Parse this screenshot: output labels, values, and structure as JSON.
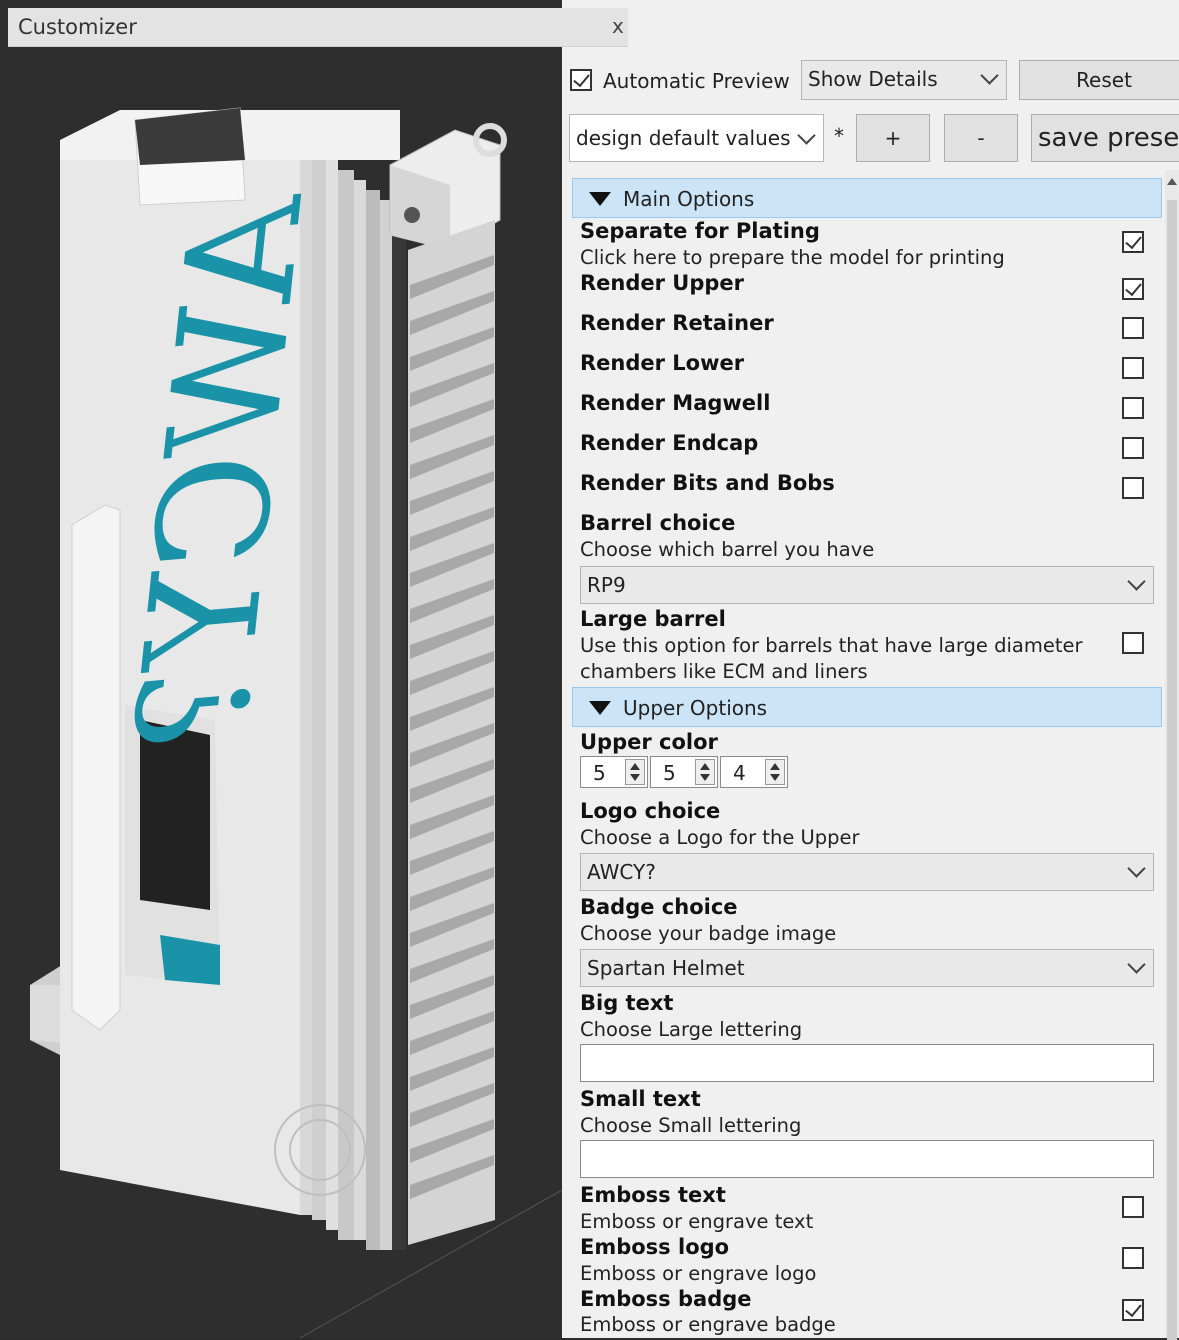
{
  "customizer": {
    "title": "Customizer",
    "close": "x",
    "auto_preview_label": "Automatic Preview",
    "auto_preview_checked": true,
    "details_select": "Show Details",
    "reset_label": "Reset",
    "preset_select": "design default values",
    "modified_mark": "*",
    "add_label": "+",
    "remove_label": "-",
    "save_label": "save prese"
  },
  "sections": {
    "main": "Main Options",
    "upper": "Upper Options"
  },
  "params": {
    "separate": {
      "name": "Separate for Plating",
      "desc": "Click here to prepare the model for printing",
      "checked": true
    },
    "render_upper": {
      "name": "Render Upper",
      "checked": true
    },
    "render_retainer": {
      "name": "Render Retainer",
      "checked": false
    },
    "render_lower": {
      "name": "Render Lower",
      "checked": false
    },
    "render_magwell": {
      "name": "Render Magwell",
      "checked": false
    },
    "render_endcap": {
      "name": "Render Endcap",
      "checked": false
    },
    "render_bits": {
      "name": "Render Bits and Bobs",
      "checked": false
    },
    "barrel": {
      "name": "Barrel choice",
      "desc": "Choose which barrel you have",
      "value": "RP9"
    },
    "large_barrel": {
      "name": "Large barrel",
      "desc1": "Use this option for barrels that have large diameter",
      "desc2": "chambers like ECM and liners",
      "checked": false
    },
    "upper_color": {
      "name": "Upper color",
      "v1": "5",
      "v2": "5",
      "v3": "4"
    },
    "logo": {
      "name": "Logo choice",
      "desc": "Choose a Logo for the Upper",
      "value": "AWCY?"
    },
    "badge": {
      "name": "Badge choice",
      "desc": "Choose your badge image",
      "value": "Spartan Helmet"
    },
    "big_text": {
      "name": "Big text",
      "desc": "Choose Large lettering",
      "value": ""
    },
    "small_text": {
      "name": "Small text",
      "desc": "Choose Small lettering",
      "value": ""
    },
    "emboss_text": {
      "name": "Emboss text",
      "desc": "Emboss or engrave text",
      "checked": false
    },
    "emboss_logo": {
      "name": "Emboss logo",
      "desc": "Emboss or engrave logo",
      "checked": false
    },
    "emboss_badge": {
      "name": "Emboss badge",
      "desc": "Emboss or engrave badge",
      "checked": true
    }
  },
  "model": {
    "logo_text": "AWCY?",
    "logo_color": "#1a93a8",
    "body_color": "#e6e6e6"
  }
}
